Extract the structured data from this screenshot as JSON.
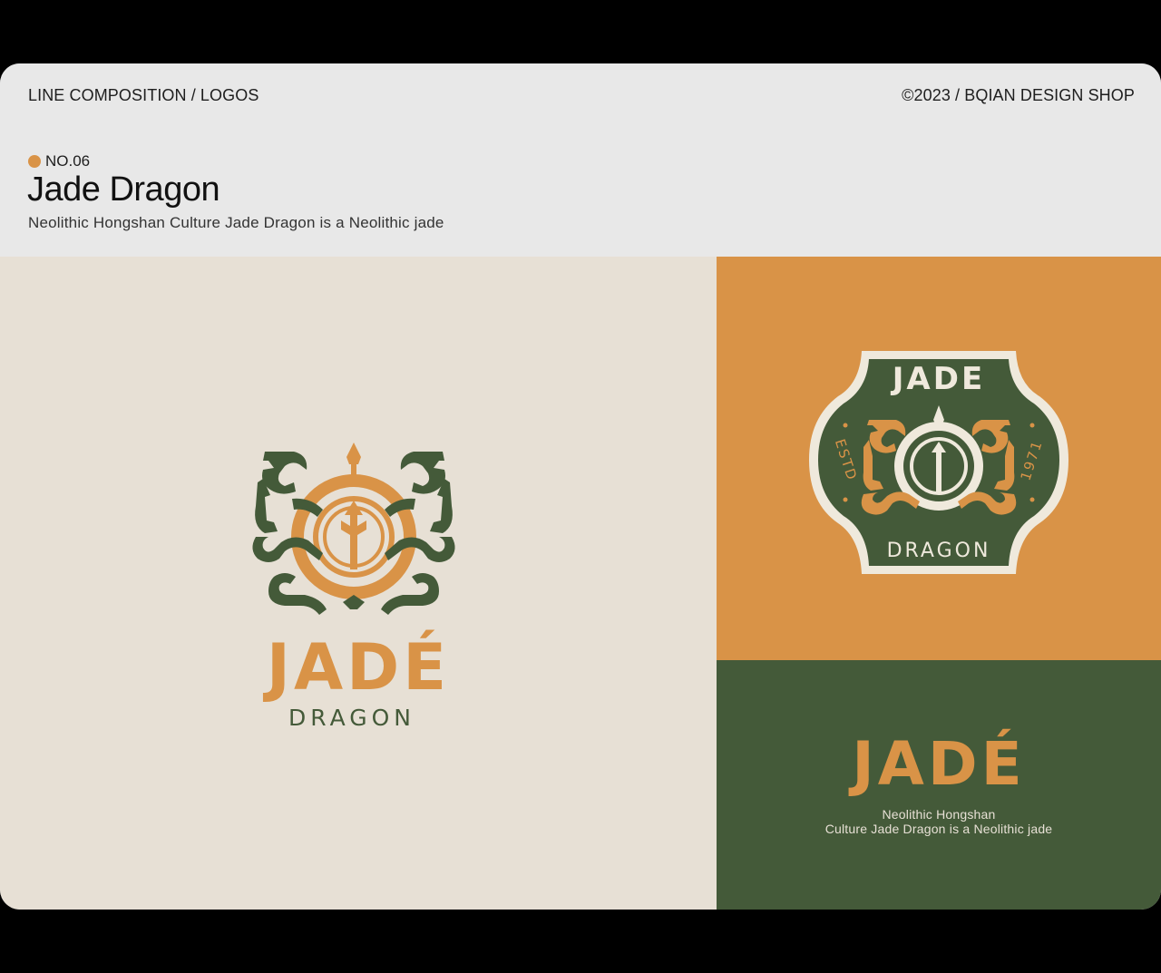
{
  "header": {
    "section": "LINE COMPOSITION / LOGOS",
    "credit": "©2023 / BQIAN DESIGN SHOP",
    "number": "NO.06",
    "title": "Jade Dragon",
    "subtitle": "Neolithic Hongshan Culture Jade Dragon is a Neolithic jade"
  },
  "main_logo": {
    "word": "JADÉ",
    "sub": "DRAGON"
  },
  "badge_logo": {
    "top": "JADE",
    "bottom": "DRAGON",
    "left_text": "ESTD",
    "right_text": "1971"
  },
  "wordmark": {
    "word": "JADÉ",
    "caption_line1": "Neolithic Hongshan",
    "caption_line2": "Culture Jade Dragon is a Neolithic jade"
  },
  "colors": {
    "orange": "#d99347",
    "green": "#445a39",
    "cream": "#e7e0d5",
    "cream_light": "#efe9dc",
    "header_bg": "#e8e8e8"
  }
}
